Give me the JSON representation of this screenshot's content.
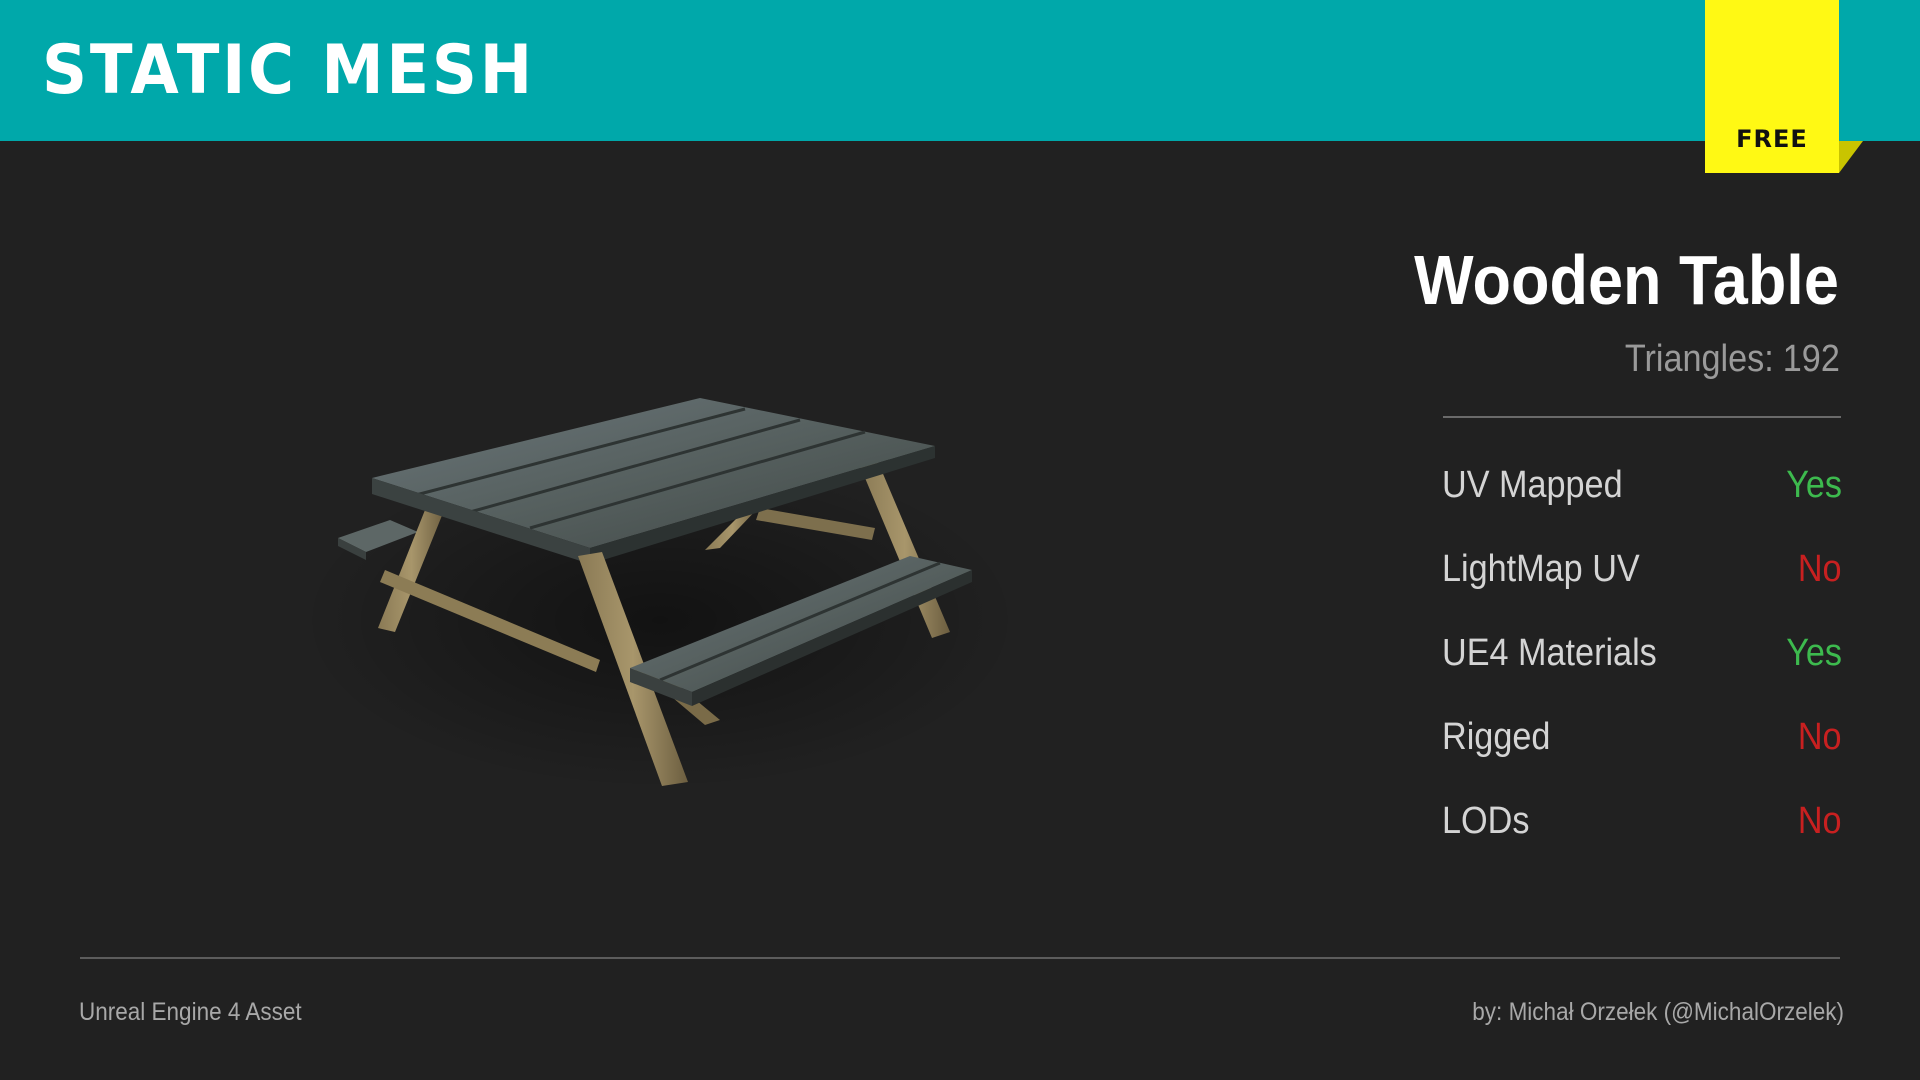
{
  "header": {
    "title": "STATIC MESH",
    "badge": "FREE"
  },
  "colors": {
    "header_bg": "#00a8aa",
    "badge_bg": "#fff914",
    "page_bg": "#212121",
    "yes": "#3dba4e",
    "no": "#c82020"
  },
  "asset": {
    "title": "Wooden Table",
    "triangles_label": "Triangles:",
    "triangles_value": "192"
  },
  "properties": [
    {
      "label": "UV Mapped",
      "value": "Yes",
      "status": "yes"
    },
    {
      "label": "LightMap UV",
      "value": "No",
      "status": "no"
    },
    {
      "label": "UE4 Materials",
      "value": "Yes",
      "status": "yes"
    },
    {
      "label": "Rigged",
      "value": "No",
      "status": "no"
    },
    {
      "label": "LODs",
      "value": "No",
      "status": "no"
    }
  ],
  "preview": {
    "icon": "picnic-table-mesh-preview"
  },
  "footer": {
    "left": "Unreal Engine 4 Asset",
    "right": "by: Michał Orzełek (@MichalOrzelek)"
  }
}
